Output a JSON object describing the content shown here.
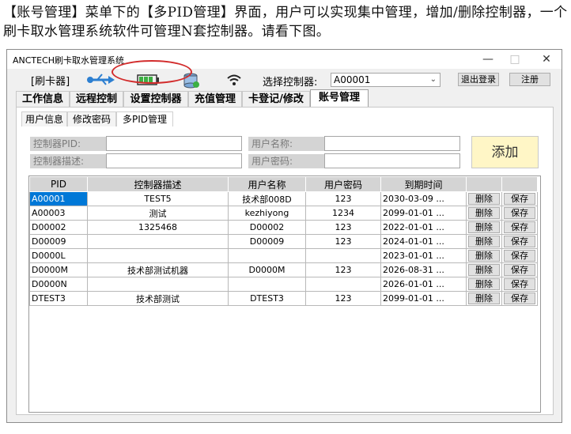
{
  "caption": "【账号管理】菜单下的【多PID管理】界面，用户可以实现集中管理，增加/删除控制器，一个刷卡取水管理系统软件可管理N套控制器。请看下图。",
  "window": {
    "title": "ANCTECH刷卡取水管理系统",
    "controls": [
      "—",
      "□",
      "✕"
    ]
  },
  "toolbar": {
    "reader_label": "[刷卡器]",
    "select_label": "选择控制器:",
    "select_value": "A00001",
    "logout": "退出登录",
    "register": "注册",
    "icons": [
      "usb-icon",
      "battery-icon",
      "database-icon",
      "wifi-icon"
    ]
  },
  "main_tabs": [
    "工作信息",
    "远程控制",
    "设置控制器",
    "充值管理",
    "卡登记/修改",
    "账号管理"
  ],
  "sub_tabs": [
    "用户信息",
    "修改密码",
    "多PID管理"
  ],
  "form": {
    "pid_label": "控制器PID:",
    "desc_label": "控制器描述:",
    "user_label": "用户名称:",
    "pwd_label": "用户密码:",
    "add_button": "添加"
  },
  "table": {
    "headers": [
      "PID",
      "控制器描述",
      "用户名称",
      "用户密码",
      "到期时间",
      "",
      ""
    ],
    "delete_label": "删除",
    "save_label": "保存",
    "rows": [
      {
        "pid": "A00001",
        "desc": "TEST5",
        "user": "技术部008D",
        "pwd": "123",
        "expire": "2030-03-09 ..."
      },
      {
        "pid": "A00003",
        "desc": "测试",
        "user": "kezhiyong",
        "pwd": "1234",
        "expire": "2099-01-01 ..."
      },
      {
        "pid": "D00002",
        "desc": "1325468",
        "user": "D00002",
        "pwd": "123",
        "expire": "2022-01-01 ..."
      },
      {
        "pid": "D00009",
        "desc": "",
        "user": "D00009",
        "pwd": "123",
        "expire": "2024-01-01 ..."
      },
      {
        "pid": "D0000L",
        "desc": "",
        "user": "",
        "pwd": "",
        "expire": "2023-01-01 ..."
      },
      {
        "pid": "D0000M",
        "desc": "技术部测试机器",
        "user": "D0000M",
        "pwd": "123",
        "expire": "2026-08-31 ..."
      },
      {
        "pid": "D0000N",
        "desc": "",
        "user": "",
        "pwd": "",
        "expire": "2026-01-01 ..."
      },
      {
        "pid": "DTEST3",
        "desc": "技术部测试",
        "user": "DTEST3",
        "pwd": "123",
        "expire": "2099-01-01 ..."
      }
    ]
  },
  "colors": {
    "accent": "#0078d7",
    "add_button_bg": "#fff6c6",
    "highlight_circle": "#d22b2b"
  }
}
